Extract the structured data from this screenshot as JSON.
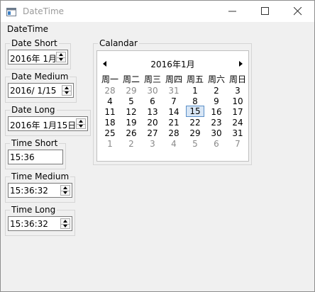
{
  "window": {
    "title": "DateTime"
  },
  "main": {
    "label": "DateTime"
  },
  "groups": {
    "date_short": {
      "legend": "Date  Short",
      "value": "2016年  1月"
    },
    "date_medium": {
      "legend": "Date  Medium",
      "value": "2016/  1/15"
    },
    "date_long": {
      "legend": "Date  Long",
      "value": "2016年  1月15日"
    },
    "time_short": {
      "legend": "Time  Short",
      "value": "15:36"
    },
    "time_medium": {
      "legend": "Time Medium",
      "value": "15:36:32"
    },
    "time_long": {
      "legend": "Time  Long",
      "value": "15:36:32"
    },
    "calendar": {
      "legend": "Calandar"
    }
  },
  "calendar": {
    "month_title": "2016年1月",
    "weekdays": [
      "周一",
      "周二",
      "周三",
      "周四",
      "周五",
      "周六",
      "周日"
    ],
    "weeks": [
      [
        {
          "d": "28",
          "o": true
        },
        {
          "d": "29",
          "o": true
        },
        {
          "d": "30",
          "o": true
        },
        {
          "d": "31",
          "o": true
        },
        {
          "d": "1"
        },
        {
          "d": "2"
        },
        {
          "d": "3"
        }
      ],
      [
        {
          "d": "4"
        },
        {
          "d": "5"
        },
        {
          "d": "6"
        },
        {
          "d": "7"
        },
        {
          "d": "8"
        },
        {
          "d": "9"
        },
        {
          "d": "10"
        }
      ],
      [
        {
          "d": "11"
        },
        {
          "d": "12"
        },
        {
          "d": "13"
        },
        {
          "d": "14"
        },
        {
          "d": "15",
          "sel": true
        },
        {
          "d": "16"
        },
        {
          "d": "17"
        }
      ],
      [
        {
          "d": "18"
        },
        {
          "d": "19"
        },
        {
          "d": "20"
        },
        {
          "d": "21"
        },
        {
          "d": "22"
        },
        {
          "d": "23"
        },
        {
          "d": "24"
        }
      ],
      [
        {
          "d": "25"
        },
        {
          "d": "26"
        },
        {
          "d": "27"
        },
        {
          "d": "28"
        },
        {
          "d": "29"
        },
        {
          "d": "30"
        },
        {
          "d": "31"
        }
      ],
      [
        {
          "d": "1",
          "o": true
        },
        {
          "d": "2",
          "o": true
        },
        {
          "d": "3",
          "o": true
        },
        {
          "d": "4",
          "o": true
        },
        {
          "d": "5",
          "o": true
        },
        {
          "d": "6",
          "o": true
        },
        {
          "d": "7",
          "o": true
        }
      ]
    ],
    "selected_color": "#d8e6f5"
  }
}
